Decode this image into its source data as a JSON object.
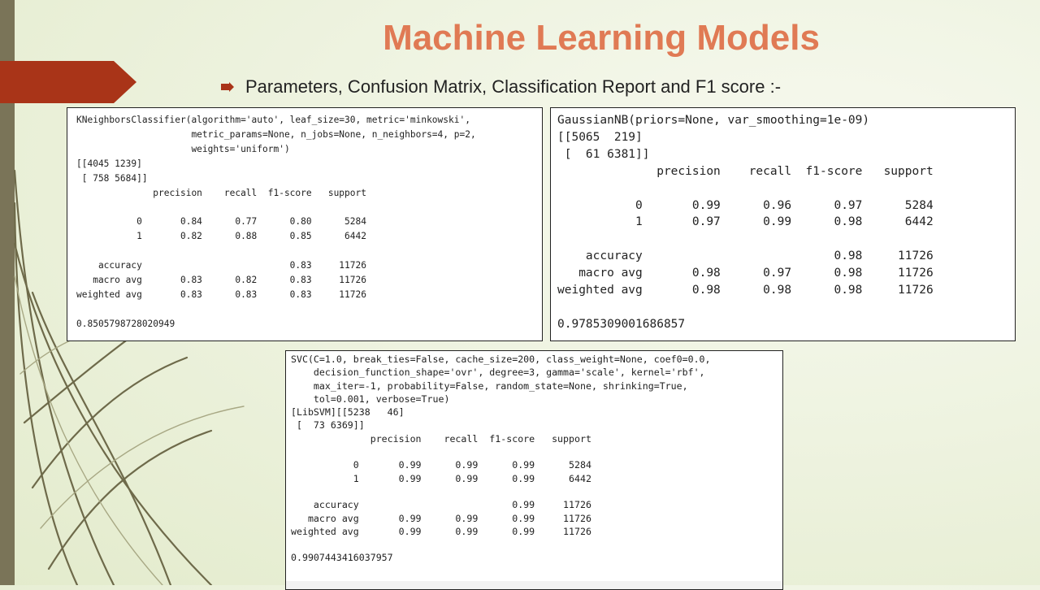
{
  "slide": {
    "title": "Machine Learning Models",
    "subtitle": "Parameters, Confusion Matrix, Classification Report and F1 score :-",
    "colors": {
      "title": "#e07a54",
      "accent_arrow": "#a93418",
      "left_strip": "#7a7458",
      "background": "#eef3e0"
    }
  },
  "knn_output": {
    "model": "KNeighborsClassifier(algorithm='auto', leaf_size=30, metric='minkowski',\n                     metric_params=None, n_jobs=None, n_neighbors=4, p=2,\n                     weights='uniform')",
    "confusion_matrix": "[[4045 1239]\n [ 758 5684]]",
    "report": "              precision    recall  f1-score   support\n\n           0       0.84      0.77      0.80      5284\n           1       0.82      0.88      0.85      6442\n\n    accuracy                           0.83     11726\n   macro avg       0.83      0.82      0.83     11726\nweighted avg       0.83      0.83      0.83     11726",
    "f1_score": "0.8505798728020949"
  },
  "gnb_output": {
    "model": "GaussianNB(priors=None, var_smoothing=1e-09)",
    "confusion_matrix": "[[5065  219]\n [  61 6381]]",
    "report": "              precision    recall  f1-score   support\n\n           0       0.99      0.96      0.97      5284\n           1       0.97      0.99      0.98      6442\n\n    accuracy                           0.98     11726\n   macro avg       0.98      0.97      0.98     11726\nweighted avg       0.98      0.98      0.98     11726",
    "f1_score": "0.9785309001686857"
  },
  "svc_output": {
    "model": "SVC(C=1.0, break_ties=False, cache_size=200, class_weight=None, coef0=0.0,\n    decision_function_shape='ovr', degree=3, gamma='scale', kernel='rbf',\n    max_iter=-1, probability=False, random_state=None, shrinking=True,\n    tol=0.001, verbose=True)",
    "confusion_matrix": "[LibSVM][[5238   46]\n [  73 6369]]",
    "report": "              precision    recall  f1-score   support\n\n           0       0.99      0.99      0.99      5284\n           1       0.99      0.99      0.99      6442\n\n    accuracy                           0.99     11726\n   macro avg       0.99      0.99      0.99     11726\nweighted avg       0.99      0.99      0.99     11726",
    "f1_score": "0.9907443416037957"
  },
  "icons": {
    "bullet": "arrow-bullet-icon",
    "decoration": "vine-decoration"
  }
}
